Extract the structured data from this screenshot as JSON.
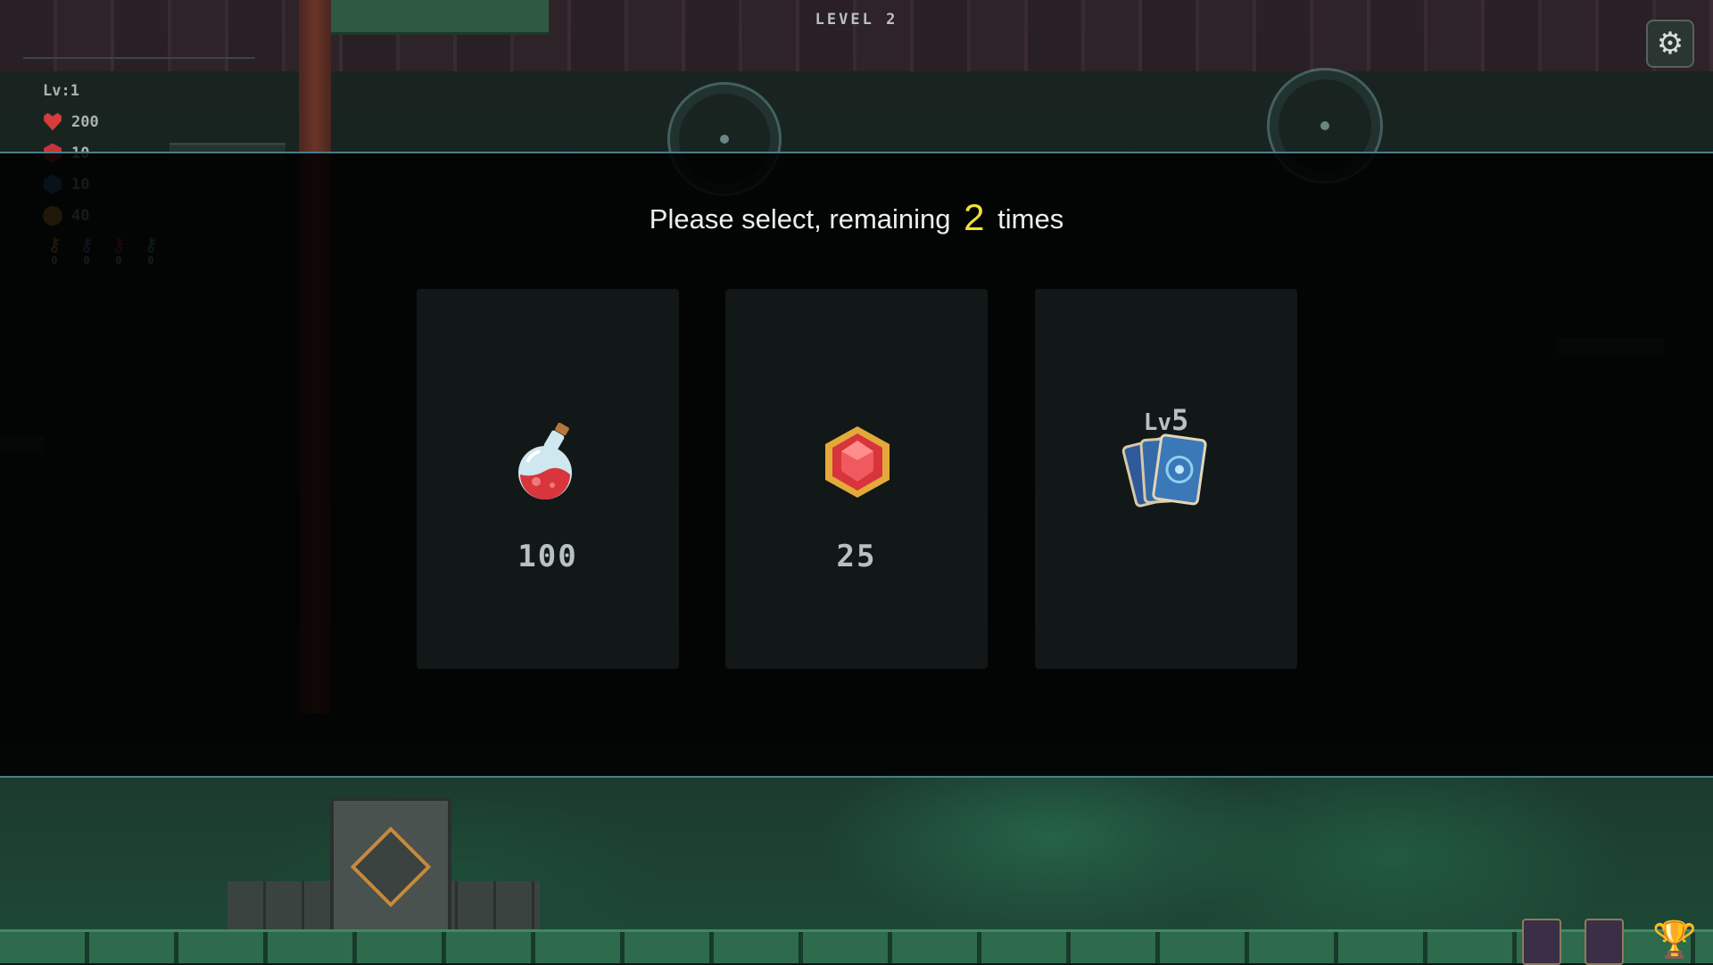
{
  "hud": {
    "level_title": "LEVEL 2",
    "player_level": "Lv:1",
    "stats": [
      {
        "icon": "heart-icon",
        "value": "200"
      },
      {
        "icon": "red-gem-icon",
        "value": "10"
      },
      {
        "icon": "blue-gem-icon",
        "value": "10"
      },
      {
        "icon": "coin-icon",
        "value": "40"
      }
    ],
    "keys": [
      {
        "icon": "yellow-key-icon",
        "color": "#d1a33b",
        "count": "0"
      },
      {
        "icon": "blue-key-icon",
        "color": "#4f8fb8",
        "count": "0"
      },
      {
        "icon": "red-key-icon",
        "color": "#c8343a",
        "count": "0"
      },
      {
        "icon": "green-key-icon",
        "color": "#4fae6a",
        "count": "0"
      }
    ],
    "settings_icon": "gear-icon"
  },
  "modal": {
    "prompt_prefix": "Please select, remaining",
    "remaining_count": "2",
    "prompt_suffix": "times",
    "choices": [
      {
        "icon": "potion-icon",
        "value": "100"
      },
      {
        "icon": "red-gem-icon",
        "value": "25"
      },
      {
        "icon": "card-deck-icon",
        "level_prefix": "Lv",
        "level_number": "5"
      }
    ]
  },
  "colors": {
    "accent_yellow": "#f1e03a",
    "modal_border": "#4a7e8c"
  }
}
